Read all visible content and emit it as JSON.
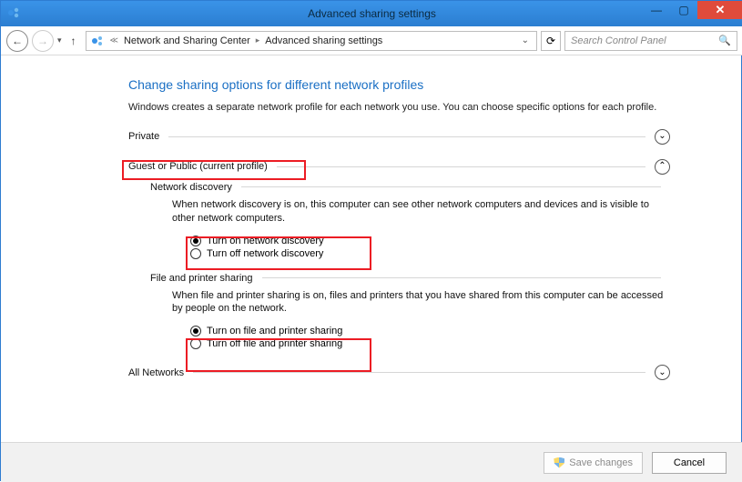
{
  "window": {
    "title": "Advanced sharing settings"
  },
  "breadcrumb": {
    "item1": "Network and Sharing Center",
    "item2": "Advanced sharing settings"
  },
  "search": {
    "placeholder": "Search Control Panel"
  },
  "heading": "Change sharing options for different network profiles",
  "intro": "Windows creates a separate network profile for each network you use. You can choose specific options for each profile.",
  "sections": {
    "private": {
      "title": "Private",
      "expanded": false
    },
    "guest": {
      "title": "Guest or Public (current profile)",
      "expanded": true,
      "network_discovery": {
        "heading": "Network discovery",
        "text": "When network discovery is on, this computer can see other network computers and devices and is visible to other network computers.",
        "opt_on": "Turn on network discovery",
        "opt_off": "Turn off network discovery",
        "selected": "on"
      },
      "file_printer": {
        "heading": "File and printer sharing",
        "text": "When file and printer sharing is on, files and printers that you have shared from this computer can be accessed by people on the network.",
        "opt_on": "Turn on file and printer sharing",
        "opt_off": "Turn off file and printer sharing",
        "selected": "on"
      }
    },
    "all": {
      "title": "All Networks",
      "expanded": false
    }
  },
  "footer": {
    "save": "Save changes",
    "cancel": "Cancel"
  }
}
